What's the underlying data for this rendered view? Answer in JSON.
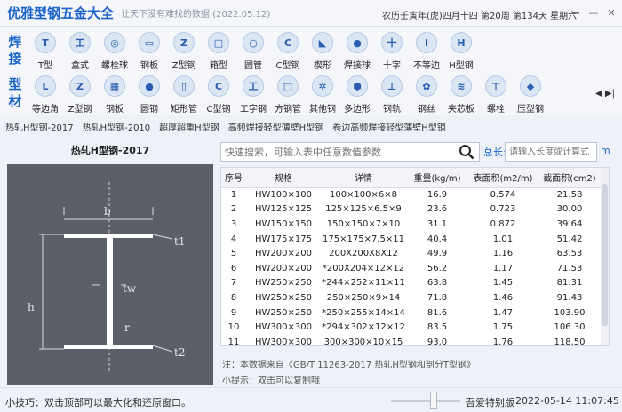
{
  "app": {
    "title": "优雅型钢五金大全",
    "slogan": "让天下没有难找的数据 (2022.05.12)",
    "lunar_date": "农历壬寅年(虎)四月十四 第20周 第134天 星期六"
  },
  "window_buttons": [
    "⊸",
    "—",
    "✕"
  ],
  "ribbon": {
    "row1_label": "焊接",
    "row1": [
      {
        "label": "T型",
        "glyph": "T"
      },
      {
        "label": "盒式",
        "glyph": "工"
      },
      {
        "label": "螺栓球",
        "glyph": "◎"
      },
      {
        "label": "钢板",
        "glyph": "▭"
      },
      {
        "label": "Z型钢",
        "glyph": "Z"
      },
      {
        "label": "箱型",
        "glyph": "□"
      },
      {
        "label": "圆管",
        "glyph": "○"
      },
      {
        "label": "C型钢",
        "glyph": "C"
      },
      {
        "label": "楔形",
        "glyph": "◣"
      },
      {
        "label": "焊接球",
        "glyph": "●"
      },
      {
        "label": "十字",
        "glyph": "十"
      },
      {
        "label": "不等边",
        "glyph": "I"
      },
      {
        "label": "H型钢",
        "glyph": "H"
      }
    ],
    "row2_label": "型材",
    "row2": [
      {
        "label": "等边角",
        "glyph": "L"
      },
      {
        "label": "Z型钢",
        "glyph": "Z"
      },
      {
        "label": "钢板",
        "glyph": "▦"
      },
      {
        "label": "圆钢",
        "glyph": "●"
      },
      {
        "label": "矩形管",
        "glyph": "▯"
      },
      {
        "label": "C型钢",
        "glyph": "C"
      },
      {
        "label": "工字钢",
        "glyph": "工"
      },
      {
        "label": "方钢管",
        "glyph": "□"
      },
      {
        "label": "其他钢",
        "glyph": "✲"
      },
      {
        "label": "多边形",
        "glyph": "⬢"
      },
      {
        "label": "钢轨",
        "glyph": "⊥"
      },
      {
        "label": "钢丝",
        "glyph": "✿"
      },
      {
        "label": "夹芯板",
        "glyph": "≋"
      },
      {
        "label": "螺栓",
        "glyph": "⊤"
      },
      {
        "label": "压型钢",
        "glyph": "◆"
      }
    ],
    "nav_arrows": "|◀ ▶|"
  },
  "subtabs": [
    "热轧H型钢-2017",
    "热轧H型钢-2010",
    "超厚超重H型钢",
    "高频焊接轻型薄壁H型钢",
    "卷边高频焊接轻型薄壁H型钢"
  ],
  "section_title": "热轧H型钢-2017",
  "diagram_labels": {
    "b": "b",
    "h": "h",
    "tw": "tw",
    "t1": "t1",
    "t2": "t2",
    "r": "r"
  },
  "search": {
    "placeholder": "快速搜索，可输入表中任意数值参数",
    "length_label": "总长:",
    "length_placeholder": "请输入长度或计算式",
    "unit": "m"
  },
  "table": {
    "headers": [
      "序号",
      "规格",
      "详情",
      "重量(kg/m)",
      "表面积(m2/m)",
      "截面积(cm2)"
    ],
    "rows": [
      [
        "1",
        "HW100×100",
        "100×100×6×8",
        "16.9",
        "0.574",
        "21.58"
      ],
      [
        "2",
        "HW125×125",
        "125×125×6.5×9",
        "23.6",
        "0.723",
        "30.00"
      ],
      [
        "3",
        "HW150×150",
        "150×150×7×10",
        "31.1",
        "0.872",
        "39.64"
      ],
      [
        "4",
        "HW175×175",
        "175×175×7.5×11",
        "40.4",
        "1.01",
        "51.42"
      ],
      [
        "5",
        "HW200×200",
        "200X200X8X12",
        "49.9",
        "1.16",
        "63.53"
      ],
      [
        "6",
        "HW200×200",
        "*200X204×12×12",
        "56.2",
        "1.17",
        "71.53"
      ],
      [
        "7",
        "HW250×250",
        "*244×252×11×11",
        "63.8",
        "1.45",
        "81.31"
      ],
      [
        "8",
        "HW250×250",
        "250×250×9×14",
        "71.8",
        "1.46",
        "91.43"
      ],
      [
        "9",
        "HW250×250",
        "*250×255×14×14",
        "81.6",
        "1.47",
        "103.90"
      ],
      [
        "10",
        "HW300×300",
        "*294×302×12×12",
        "83.5",
        "1.75",
        "106.30"
      ],
      [
        "11",
        "HW300×300",
        "300×300×10×15",
        "93.0",
        "1.76",
        "118.50"
      ]
    ]
  },
  "note": "注：本数据来自《GB/T 11263-2017 热轧H型钢和剖分T型钢》",
  "hint": "小提示：双击可以复制哦",
  "status": {
    "tip": "小技巧：双击顶部可以最大化和还原窗口。",
    "edition": "吾爱特别版",
    "datetime": "2022-05-14 11:07:45"
  }
}
